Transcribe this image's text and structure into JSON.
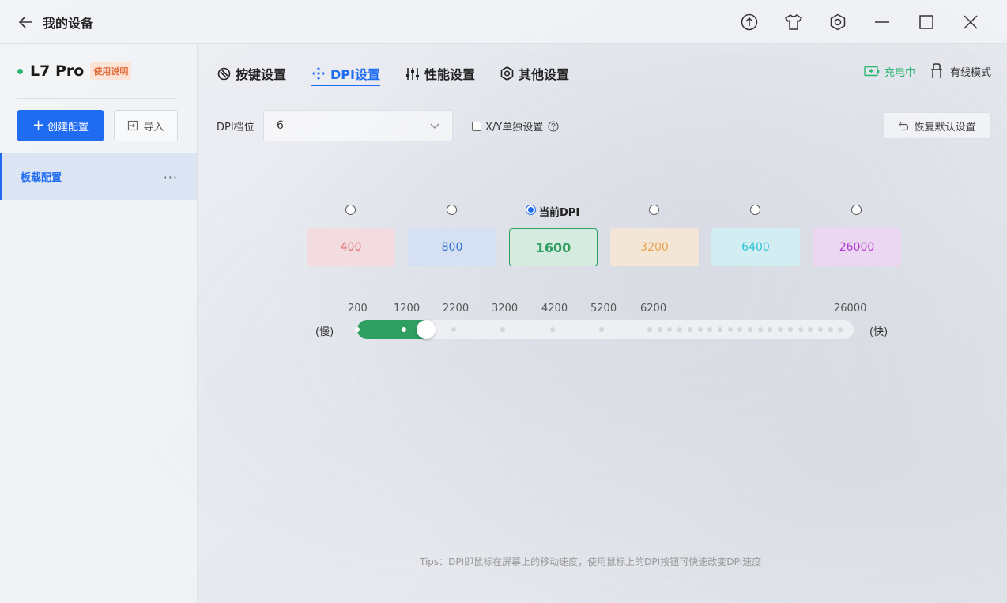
{
  "window": {
    "title": "我的设备"
  },
  "sidebar": {
    "device_name": "L7 Pro",
    "manual_badge": "使用说明",
    "create_label": "创建配置",
    "import_label": "导入",
    "configs": [
      {
        "label": "板载配置",
        "more": "···"
      }
    ]
  },
  "tabs": [
    {
      "label": "按键设置",
      "icon": "key-icon",
      "active": false
    },
    {
      "label": "DPI设置",
      "icon": "dpi-icon",
      "active": true
    },
    {
      "label": "性能设置",
      "icon": "sliders-icon",
      "active": false
    },
    {
      "label": "其他设置",
      "icon": "hexagon-gear-icon",
      "active": false
    }
  ],
  "status": {
    "charging": "充电中",
    "mode": "有线模式"
  },
  "dpi": {
    "level_label": "DPI档位",
    "level_value": "6",
    "xy_label": "X/Y单独设置",
    "reset_label": "恢复默认设置",
    "current_label": "当前DPI",
    "current_index": 2,
    "presets": [
      {
        "value": "400",
        "text_color": "#e06b6b",
        "bg_color": "#f2dcdf"
      },
      {
        "value": "800",
        "text_color": "#2f6fd6",
        "bg_color": "#d5e0f3"
      },
      {
        "value": "1600",
        "text_color": "#2e9e61",
        "bg_color": "#d6ebdf"
      },
      {
        "value": "3200",
        "text_color": "#e9a24c",
        "bg_color": "#f4e6d6"
      },
      {
        "value": "6400",
        "text_color": "#2ec3d6",
        "bg_color": "#d3eef2"
      },
      {
        "value": "26000",
        "text_color": "#b23ad0",
        "bg_color": "#ecd7f2"
      }
    ]
  },
  "slider": {
    "min_label": "(慢)",
    "max_label": "(快)",
    "ticks": [
      "200",
      "1200",
      "2200",
      "3200",
      "4200",
      "5200",
      "6200",
      "26000"
    ],
    "value": 1600,
    "fill_color": "#2e9e61"
  },
  "tips": "Tips：DPI即鼠标在屏幕上的移动速度，使用鼠标上的DPI按钮可快速改变DPI速度"
}
